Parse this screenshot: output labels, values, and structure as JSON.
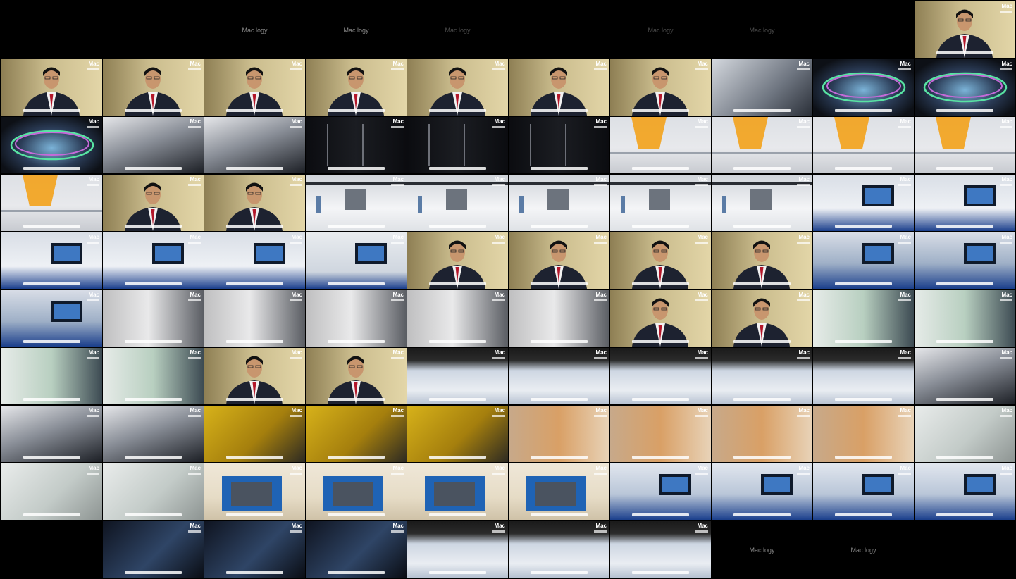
{
  "brand": {
    "logo_text": "Mac",
    "watermark": "Mac logy"
  },
  "colors": {
    "studio": "#c9bb8c",
    "studio_dark": "#8e7f54",
    "suit": "#1d2230",
    "skin": "#c8966e",
    "hair": "#121212",
    "tie": "#b3172a",
    "render_white": "#e8e9ec",
    "render_dark": "#111318",
    "showroom": "#cdd6e2",
    "floor_blue": "#1b3f8c",
    "warm": "#d9a066",
    "amber": "#f3a21b",
    "yellow_desk": "#d7b21a",
    "blue_pad": "#1f63b5"
  },
  "frames": [
    "blank",
    "blank",
    "wm",
    "wm",
    "wm-dim",
    "blank",
    "wm-dim",
    "wm-dim",
    "blank",
    "studio-interview",
    "studio-interview",
    "studio-interview",
    "studio-interview",
    "studio-interview",
    "studio-interview",
    "studio-interview",
    "studio-interview",
    "hand-on-panel",
    "ring-render",
    "ring-render",
    "ring-render",
    "glass-display",
    "glass-display",
    "dark-panels",
    "dark-panels",
    "dark-panels",
    "robot-render",
    "robot-render",
    "robot-render",
    "robot-render",
    "robot-render",
    "studio-interview",
    "studio-interview",
    "factory-render",
    "factory-render",
    "factory-render",
    "factory-render",
    "factory-render",
    "showroom-gesture",
    "showroom-gesture",
    "showroom-gesture",
    "showroom-gesture",
    "showroom-gesture",
    "kiosk",
    "studio-interview",
    "studio-interview",
    "studio-interview",
    "studio-interview",
    "monitor-touch",
    "monitor-touch",
    "monitor-touch",
    "white-board",
    "white-board",
    "white-board",
    "white-board",
    "white-board",
    "studio-interview",
    "studio-interview",
    "printing-glass",
    "printing-glass",
    "printing-glass",
    "printing-glass",
    "studio-interview",
    "studio-interview",
    "showroom-hall",
    "showroom-hall",
    "showroom-hall",
    "showroom-hall",
    "showroom-hall",
    "glass-display",
    "glass-display",
    "glass-display",
    "yellow-desk",
    "yellow-desk",
    "yellow-desk",
    "warm-robot",
    "warm-robot",
    "warm-robot",
    "warm-robot",
    "hands-film",
    "hands-film",
    "hands-film",
    "blue-pad",
    "blue-pad",
    "blue-pad",
    "blue-pad",
    "monitor-desk",
    "monitor-desk",
    "monitor-desk",
    "monitor-desk",
    "black",
    "dark-screens",
    "dark-screens",
    "dark-screens",
    "showroom-hall",
    "showroom-hall",
    "showroom-hall",
    "wm",
    "wm"
  ]
}
